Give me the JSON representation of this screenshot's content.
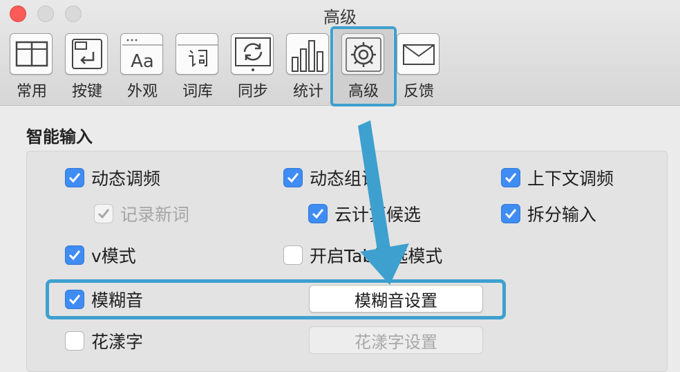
{
  "window": {
    "title": "高级"
  },
  "toolbar": {
    "items": [
      {
        "label": "常用",
        "icon": "general-layout-icon"
      },
      {
        "label": "按键",
        "icon": "keyboard-return-icon"
      },
      {
        "label": "外观",
        "icon": "appearance-aa-icon"
      },
      {
        "label": "词库",
        "icon": "dictionary-icon"
      },
      {
        "label": "同步",
        "icon": "sync-icon"
      },
      {
        "label": "统计",
        "icon": "statistics-icon"
      },
      {
        "label": "高级",
        "icon": "gear-icon",
        "selected": true
      },
      {
        "label": "反馈",
        "icon": "envelope-icon"
      }
    ]
  },
  "section": {
    "title": "智能输入"
  },
  "options": {
    "dynamic_freq": {
      "label": "动态调频",
      "checked": true
    },
    "dynamic_phrase": {
      "label": "动态组词",
      "checked": true
    },
    "context_freq": {
      "label": "上下文调频",
      "checked": true
    },
    "record_new_words": {
      "label": "记录新词",
      "checked": true,
      "disabled": true
    },
    "cloud_candidates": {
      "label": "云计算候选",
      "checked": true
    },
    "split_input": {
      "label": "拆分输入",
      "checked": true
    },
    "v_mode": {
      "label": "v模式",
      "checked": true
    },
    "tab_mode": {
      "label": "开启Tab筛选模式",
      "checked": false
    },
    "fuzzy_pinyin": {
      "label": "模糊音",
      "checked": true
    },
    "fancy_chars": {
      "label": "花漾字",
      "checked": false
    }
  },
  "buttons": {
    "fuzzy_settings": "模糊音设置",
    "fancy_settings": "花漾字设置"
  },
  "colors": {
    "highlight": "#3ea0cf",
    "checkbox_on": "#3f8cf3"
  }
}
